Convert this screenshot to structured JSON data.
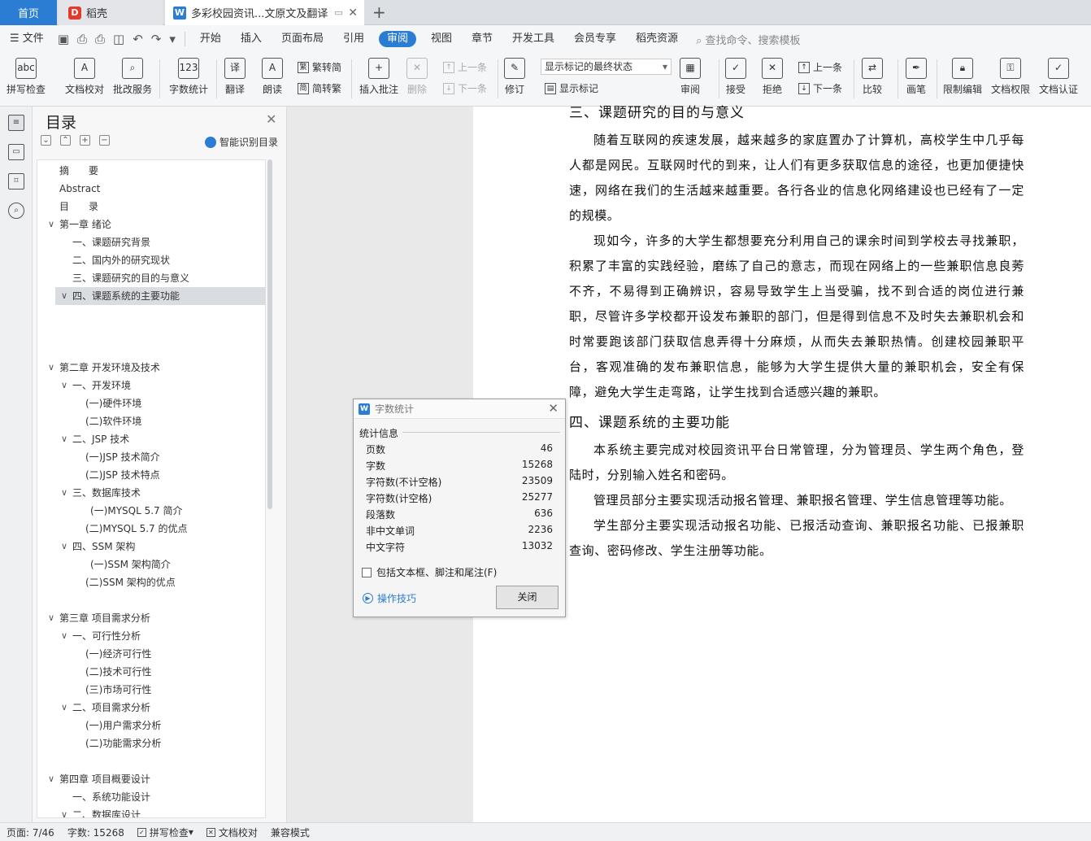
{
  "tabs": {
    "home": "首页",
    "daoke": "稻壳",
    "document": "多彩校园资讯...文原文及翻译",
    "new_tab": "+"
  },
  "menu": {
    "file": "文件",
    "items": [
      "开始",
      "插入",
      "页面布局",
      "引用",
      "审阅",
      "视图",
      "章节",
      "开发工具",
      "会员专享",
      "稻壳资源"
    ],
    "active": "审阅",
    "search": "查找命令、搜索模板"
  },
  "ribbon": {
    "spell_check": "拼写检查",
    "doc_proof": "文档校对",
    "batch_service": "批改服务",
    "word_count": "字数统计",
    "translate": "翻译",
    "read_aloud": "朗读",
    "to_traditional": "繁转简",
    "to_simplified": "简转繁",
    "insert_comment": "插入批注",
    "delete": "删除",
    "prev_comment": "上一条",
    "next_comment": "下一条",
    "revise": "修订",
    "markup_state": "显示标记的最终状态",
    "show_markup": "显示标记",
    "review": "审阅",
    "accept": "接受",
    "reject": "拒绝",
    "prev_change": "上一条",
    "next_change": "下一条",
    "compare": "比较",
    "ink": "画笔",
    "restrict_edit": "限制编辑",
    "doc_permission": "文档权限",
    "doc_cert": "文档认证"
  },
  "toc": {
    "title": "目录",
    "smart": "智能识别目录",
    "items": [
      {
        "text": "摘　　要"
      },
      {
        "text": "Abstract"
      },
      {
        "text": "目　　录"
      },
      {
        "text": "第一章  绪论"
      },
      {
        "text": "一、课题研究背景"
      },
      {
        "text": "二、国内外的研究现状"
      },
      {
        "text": "三、课题研究的目的与意义"
      },
      {
        "text": "四、课题系统的主要功能"
      },
      {
        "text": "第二章  开发环境及技术"
      },
      {
        "text": "一、开发环境"
      },
      {
        "text": "(一)硬件环境"
      },
      {
        "text": "(二)软件环境"
      },
      {
        "text": "二、JSP 技术"
      },
      {
        "text": "(一)JSP 技术简介"
      },
      {
        "text": "(二)JSP 技术特点"
      },
      {
        "text": "三、数据库技术"
      },
      {
        "text": "(一)MYSQL 5.7 简介"
      },
      {
        "text": "(二)MYSQL 5.7 的优点"
      },
      {
        "text": "四、SSM 架构"
      },
      {
        "text": "(一)SSM 架构简介"
      },
      {
        "text": "(二)SSM 架构的优点"
      },
      {
        "text": "第三章  项目需求分析"
      },
      {
        "text": "一、可行性分析"
      },
      {
        "text": "(一)经济可行性"
      },
      {
        "text": "(二)技术可行性"
      },
      {
        "text": "(三)市场可行性"
      },
      {
        "text": "二、项目需求分析"
      },
      {
        "text": "(一)用户需求分析"
      },
      {
        "text": "(二)功能需求分析"
      },
      {
        "text": "第四章  项目概要设计"
      },
      {
        "text": "一、系统功能设计"
      },
      {
        "text": "二、数据库设计"
      }
    ]
  },
  "document": {
    "heading_top": "三、课题研究的目的与意义",
    "para1": "随着互联网的疾速发展，越来越多的家庭置办了计算机，高校学生中几乎每人都是网民。互联网时代的到来，让人们有更多获取信息的途径，也更加便捷快速，网络在我们的生活越来越重要。各行各业的信息化网络建设也已经有了一定的规模。",
    "para2": " 现如今，许多的大学生都想要充分利用自己的课余时间到学校去寻找兼职，积累了丰富的实践经验，磨练了自己的意志，而现在网络上的一些兼职信息良莠不齐，不易得到正确辨识，容易导致学生上当受骗，找不到合适的岗位进行兼职，尽管许多学校都开设发布兼职的部门，但是得到信息不及时失去兼职机会和时常要跑该部门获取信息弄得十分麻烦，从而失去兼职热情。创建校园兼职平台，客观准确的发布兼职信息，能够为大学生提供大量的兼职机会，安全有保障，避免大学生走弯路，让学生找到合适感兴趣的兼职。",
    "heading2": "四、课题系统的主要功能",
    "para3": "本系统主要完成对校园资讯平台日常管理，分为管理员、学生两个角色，登陆时，分别输入姓名和密码。",
    "para4": "管理员部分主要实现活动报名管理、兼职报名管理、学生信息管理等功能。",
    "para5": "学生部分主要实现活动报名功能、已报活动查询、兼职报名功能、已报兼职查询、密码修改、学生注册等功能。"
  },
  "dialog": {
    "title": "字数统计",
    "section": "统计信息",
    "stats": [
      {
        "label": "页数",
        "value": "46"
      },
      {
        "label": "字数",
        "value": "15268"
      },
      {
        "label": "字符数(不计空格)",
        "value": "23509"
      },
      {
        "label": "字符数(计空格)",
        "value": "25277"
      },
      {
        "label": "段落数",
        "value": "636"
      },
      {
        "label": "非中文单词",
        "value": "2236"
      },
      {
        "label": "中文字符",
        "value": "13032"
      }
    ],
    "include_label": "包括文本框、脚注和尾注(F)",
    "tips": "操作技巧",
    "close": "关闭"
  },
  "status": {
    "page": "页面: 7/46",
    "words": "字数: 15268",
    "spell": "拼写检查",
    "proof": "文档校对",
    "compat": "兼容模式"
  }
}
